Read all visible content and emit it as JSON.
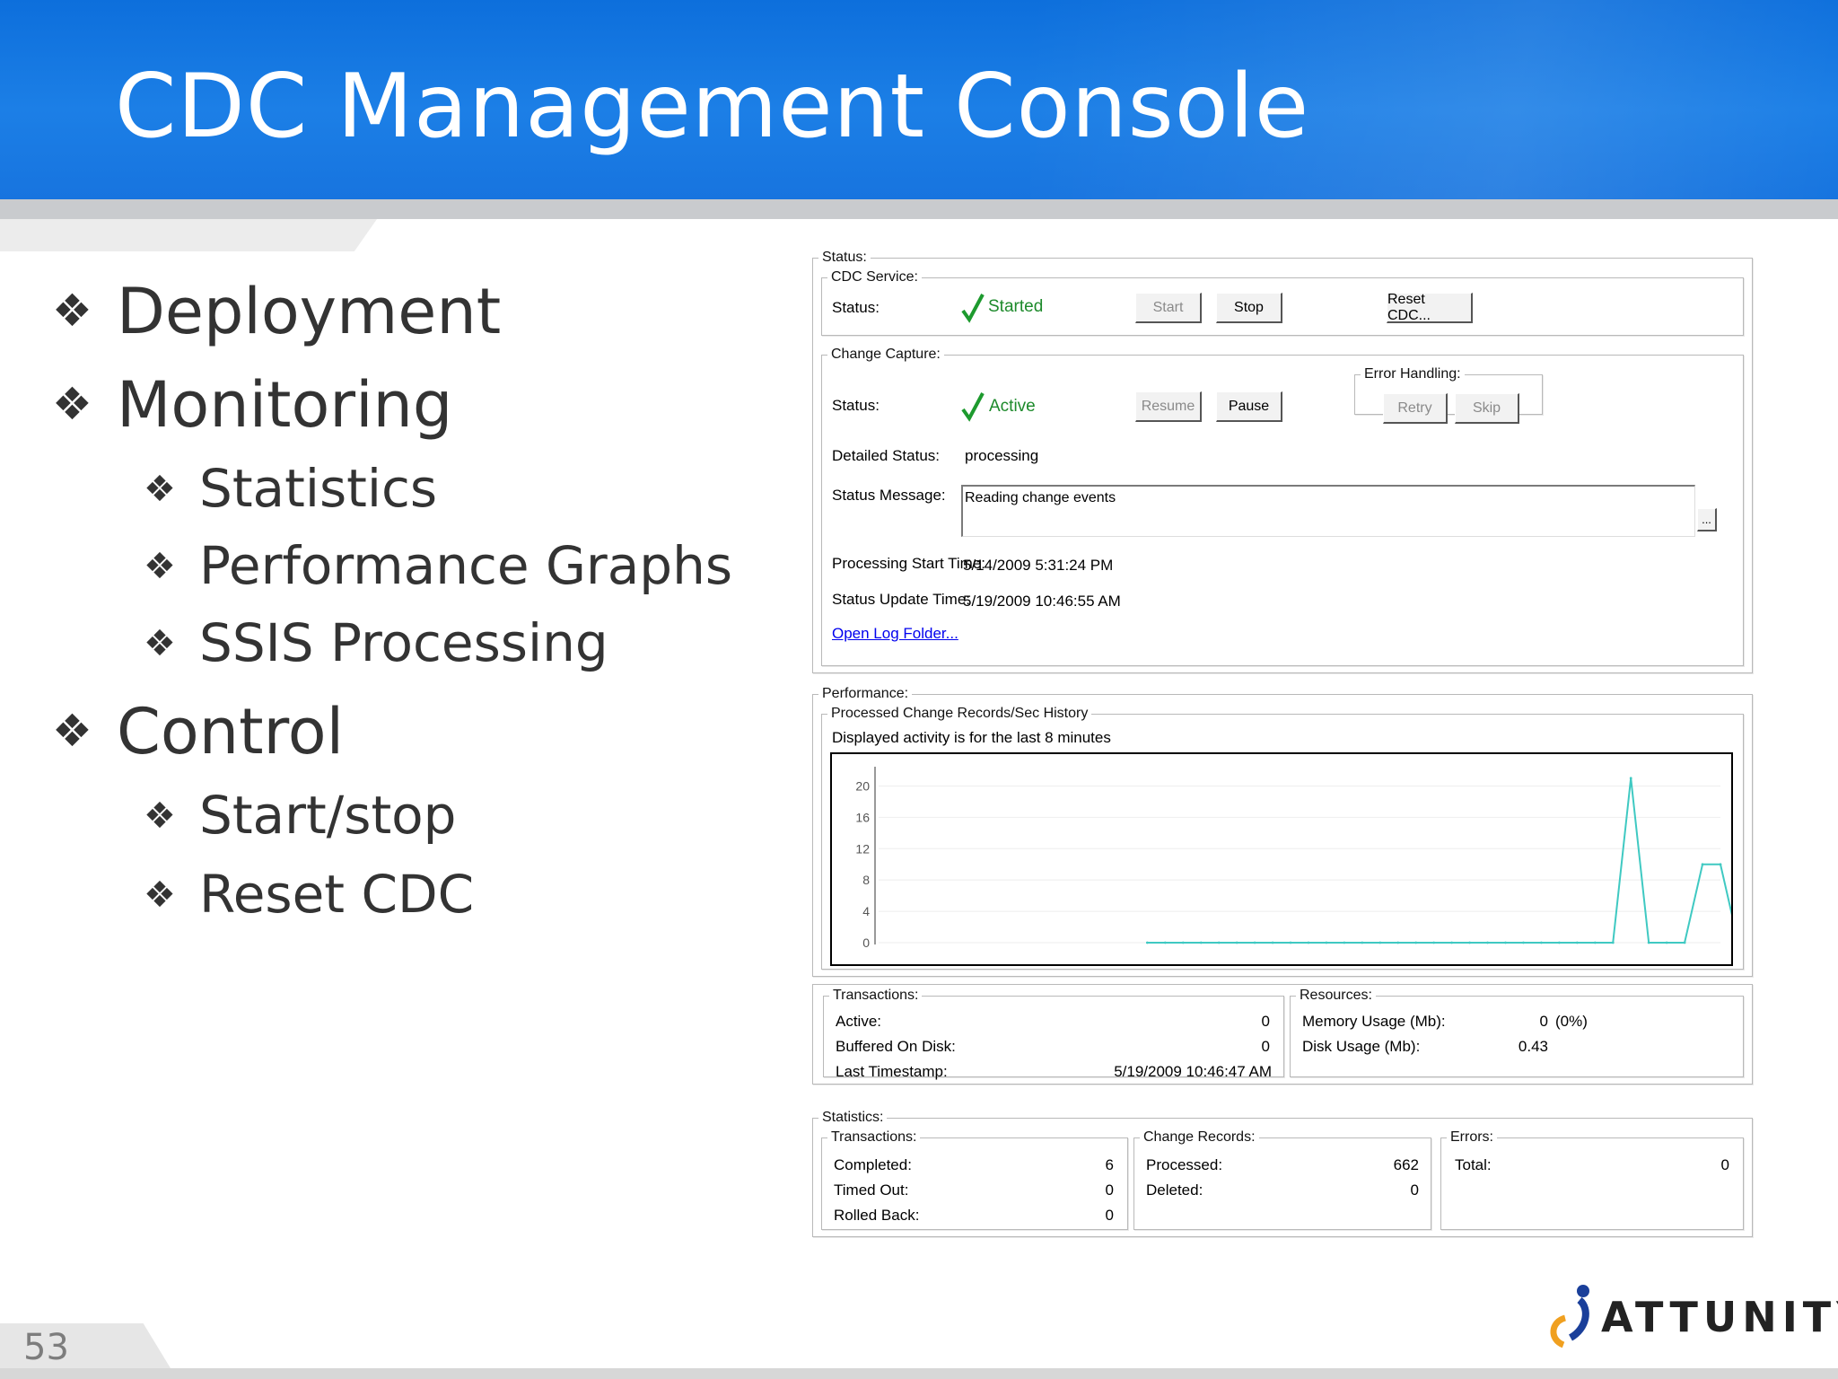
{
  "slide": {
    "title": "CDC Management Console",
    "page_number": "53",
    "logo_text": "ATTUNITY",
    "bullets": [
      {
        "level": 1,
        "text": "Deployment"
      },
      {
        "level": 1,
        "text": "Monitoring"
      },
      {
        "level": 2,
        "text": "Statistics"
      },
      {
        "level": 2,
        "text": "Performance Graphs"
      },
      {
        "level": 2,
        "text": "SSIS Processing"
      },
      {
        "level": 1,
        "text": "Control"
      },
      {
        "level": 2,
        "text": "Start/stop"
      },
      {
        "level": 2,
        "text": "Reset CDC"
      }
    ],
    "bullet_mark": "❖"
  },
  "console": {
    "status_group": "Status:",
    "cdc_service": {
      "legend": "CDC Service:",
      "status_label": "Status:",
      "status_value": "Started",
      "buttons": {
        "start": "Start",
        "stop": "Stop",
        "reset": "Reset CDC..."
      }
    },
    "change_capture": {
      "legend": "Change Capture:",
      "status_label": "Status:",
      "status_value": "Active",
      "buttons": {
        "resume": "Resume",
        "pause": "Pause"
      },
      "error_handling": {
        "legend": "Error Handling:",
        "retry": "Retry",
        "skip": "Skip"
      },
      "detailed_status_label": "Detailed Status:",
      "detailed_status_value": "processing",
      "status_message_label": "Status Message:",
      "status_message_value": "Reading change events",
      "ellipsis_button": "...",
      "processing_start_label": "Processing Start Time:",
      "processing_start_value": "5/14/2009 5:31:24 PM",
      "status_update_label": "Status Update Time:",
      "status_update_value": "5/19/2009 10:46:55 AM",
      "open_log_link": "Open Log Folder..."
    },
    "performance": {
      "legend": "Performance:",
      "history_legend": "Processed Change Records/Sec History",
      "note": "Displayed activity is for the last 8 minutes"
    },
    "transactions": {
      "legend": "Transactions:",
      "rows": [
        {
          "label": "Active:",
          "value": "0"
        },
        {
          "label": "Buffered On Disk:",
          "value": "0"
        },
        {
          "label": "Last Timestamp:",
          "value": "5/19/2009 10:46:47 AM"
        }
      ]
    },
    "resources": {
      "legend": "Resources:",
      "memory_label": "Memory Usage (Mb):",
      "memory_value": "0",
      "memory_pct": "(0%)",
      "disk_label": "Disk Usage (Mb):",
      "disk_value": "0.43"
    },
    "statistics": {
      "legend": "Statistics:",
      "transactions": {
        "legend": "Transactions:",
        "rows": [
          {
            "label": "Completed:",
            "value": "6"
          },
          {
            "label": "Timed Out:",
            "value": "0"
          },
          {
            "label": "Rolled Back:",
            "value": "0"
          }
        ]
      },
      "change_records": {
        "legend": "Change Records:",
        "rows": [
          {
            "label": "Processed:",
            "value": "662"
          },
          {
            "label": "Deleted:",
            "value": "0"
          }
        ]
      },
      "errors": {
        "legend": "Errors:",
        "rows": [
          {
            "label": "Total:",
            "value": "0"
          }
        ]
      }
    }
  },
  "chart_data": {
    "type": "line",
    "title": "Processed Change Records/Sec History",
    "subtitle": "Displayed activity is for the last 8 minutes",
    "xlabel": "",
    "ylabel": "",
    "y_ticks": [
      "20",
      "16",
      "12",
      "8",
      "4",
      "0"
    ],
    "ylim": [
      0,
      22
    ],
    "x_points": 48,
    "start_index": 15,
    "series": [
      {
        "color": "#3fc9c2",
        "values": [
          0,
          0,
          0,
          0,
          0,
          0,
          0,
          0,
          0,
          0,
          0,
          0,
          0,
          0,
          0,
          0,
          0,
          0,
          0,
          0,
          0,
          0,
          0,
          0,
          0,
          0,
          0,
          21,
          0,
          0,
          0,
          10,
          10,
          0
        ]
      }
    ],
    "grid": true,
    "legend": "none"
  }
}
